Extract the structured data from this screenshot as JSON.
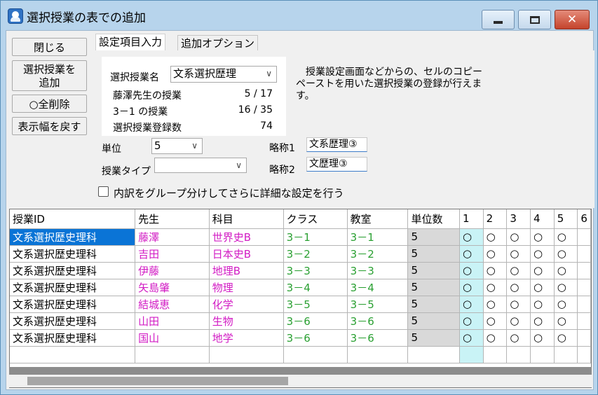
{
  "window": {
    "title": "選択授業の表での追加",
    "controls": {
      "minimize": "minimize",
      "maximize": "maximize",
      "close": "✕"
    }
  },
  "sidebar": {
    "close_label": "閉じる",
    "add_line1": "選択授業を",
    "add_line2": "追加",
    "delete_all_label": "○全削除",
    "reset_width_label": "表示幅を戻す"
  },
  "tabs": [
    {
      "label": "設定項目入力",
      "active": true
    },
    {
      "label": "追加オプション",
      "active": false
    }
  ],
  "settings": {
    "class_name_label": "選択授業名",
    "class_name_value": "文系選択歴理",
    "teacher_label": "藤澤先生の授業",
    "teacher_value": "5 / 17",
    "class31_label": "3－1 の授業",
    "class31_value": "16 / 35",
    "registered_label": "選択授業登録数",
    "registered_value": "74",
    "units_label": "単位",
    "units_value": "5",
    "type_label": "授業タイプ",
    "type_value": "",
    "abbr1_label": "略称1",
    "abbr1_value": "文系歴理③",
    "abbr2_label": "略称2",
    "abbr2_value": "文歴理③",
    "description": "　授業設定画面などからの、セルのコピーペーストを用いた選択授業の登録が行えます。",
    "detail_checkbox_label": "内訳をグループ分けしてさらに詳細な設定を行う",
    "detail_checked": false
  },
  "grid": {
    "columns": [
      "授業ID",
      "先生",
      "科目",
      "クラス",
      "教室",
      "単位数",
      "1",
      "2",
      "3",
      "4",
      "5",
      "6"
    ],
    "rows": [
      {
        "id": "文系選択歴史理科",
        "teacher": "藤澤",
        "subject": "世界史B",
        "cls": "3－1",
        "room": "3－1",
        "units": "5",
        "p": [
          "○",
          "○",
          "○",
          "○",
          "○"
        ]
      },
      {
        "id": "文系選択歴史理科",
        "teacher": "吉田",
        "subject": "日本史B",
        "cls": "3－2",
        "room": "3－2",
        "units": "5",
        "p": [
          "○",
          "○",
          "○",
          "○",
          "○"
        ]
      },
      {
        "id": "文系選択歴史理科",
        "teacher": "伊藤",
        "subject": "地理B",
        "cls": "3－3",
        "room": "3－3",
        "units": "5",
        "p": [
          "○",
          "○",
          "○",
          "○",
          "○"
        ]
      },
      {
        "id": "文系選択歴史理科",
        "teacher": "矢島肇",
        "subject": "物理",
        "cls": "3－4",
        "room": "3－4",
        "units": "5",
        "p": [
          "○",
          "○",
          "○",
          "○",
          "○"
        ]
      },
      {
        "id": "文系選択歴史理科",
        "teacher": "結城恵",
        "subject": "化学",
        "cls": "3－5",
        "room": "3－5",
        "units": "5",
        "p": [
          "○",
          "○",
          "○",
          "○",
          "○"
        ]
      },
      {
        "id": "文系選択歴史理科",
        "teacher": "山田",
        "subject": "生物",
        "cls": "3－6",
        "room": "3－6",
        "units": "5",
        "p": [
          "○",
          "○",
          "○",
          "○",
          "○"
        ]
      },
      {
        "id": "文系選択歴史理科",
        "teacher": "国山",
        "subject": "地学",
        "cls": "3－6",
        "room": "3－6",
        "units": "5",
        "p": [
          "○",
          "○",
          "○",
          "○",
          "○"
        ]
      }
    ]
  }
}
